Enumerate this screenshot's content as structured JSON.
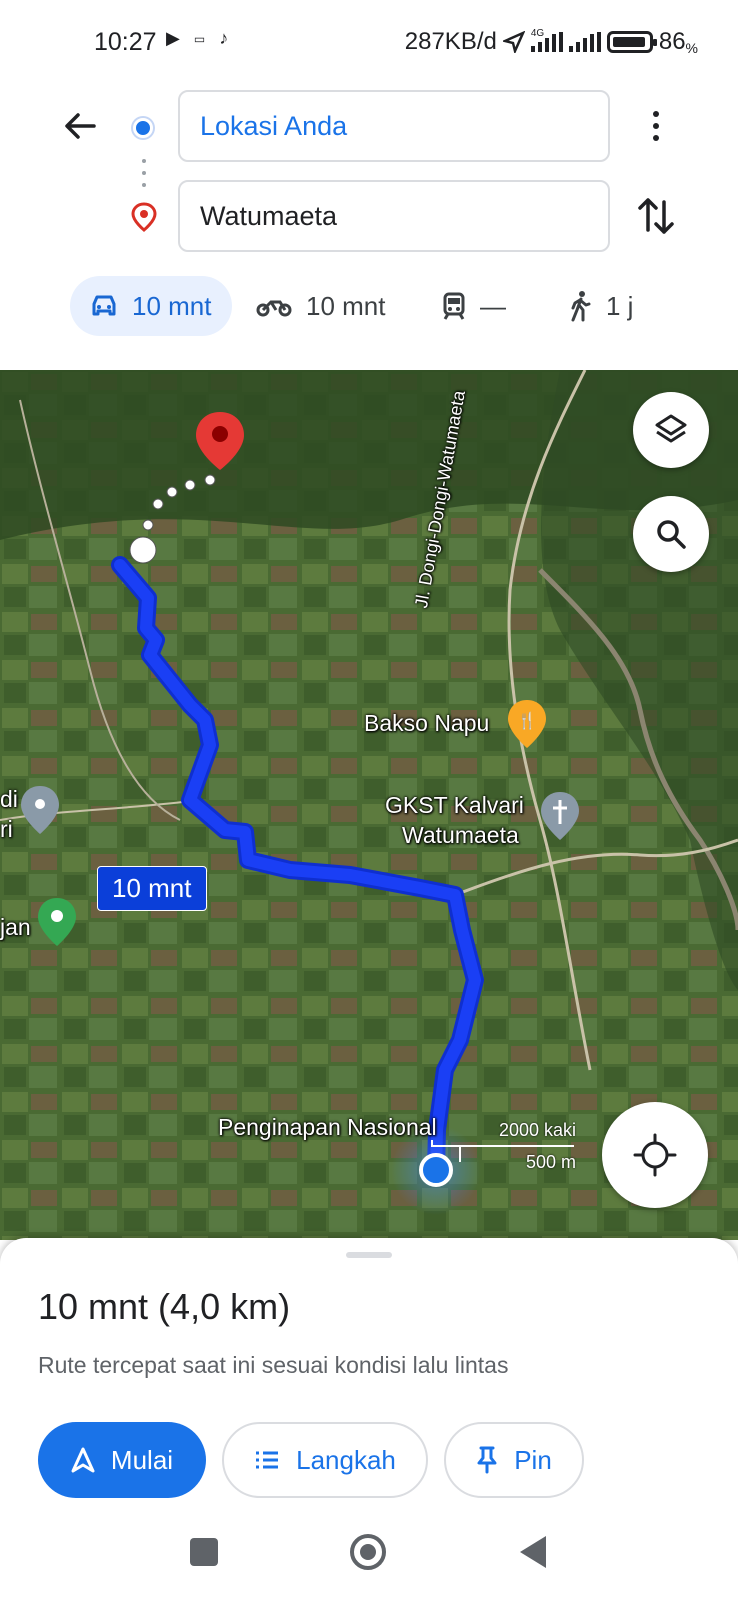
{
  "status_bar": {
    "time": "10:27",
    "data_rate": "287KB/d",
    "network": "4G",
    "battery": "86",
    "battery_unit": "%"
  },
  "directions": {
    "origin": "Lokasi Anda",
    "destination": "Watumaeta",
    "modes": [
      {
        "name": "car",
        "icon": "car-icon",
        "label": "10 mnt",
        "active": true
      },
      {
        "name": "motorcycle",
        "icon": "motorcycle-icon",
        "label": "10 mnt",
        "active": false
      },
      {
        "name": "transit",
        "icon": "train-icon",
        "label": "—",
        "active": false
      },
      {
        "name": "walk",
        "icon": "walk-icon",
        "label": "1 j",
        "active": false
      }
    ]
  },
  "map": {
    "labels": {
      "road": "Jl. Dongi-Dongi-Watumaeta",
      "bakso": "Bakso Napu",
      "church_line1": "GKST Kalvari",
      "church_line2": "Watumaeta",
      "left_top": "di",
      "left_bottom": "ri",
      "left_green": "jan",
      "lodging": "Penginapan Nasional"
    },
    "route_badge": "10 mnt",
    "scale_imperial": "2000 kaki",
    "scale_metric": "500 m",
    "route_color": "#1a3ff5"
  },
  "sheet": {
    "title": "10 mnt (4,0 km)",
    "subtitle": "Rute tercepat saat ini sesuai kondisi lalu lintas",
    "start_label": "Mulai",
    "steps_label": "Langkah",
    "pin_label": "Pin"
  },
  "colors": {
    "accent": "#1a73e8",
    "active_chip": "#e8f0fe",
    "dest_pin": "#d93025"
  }
}
